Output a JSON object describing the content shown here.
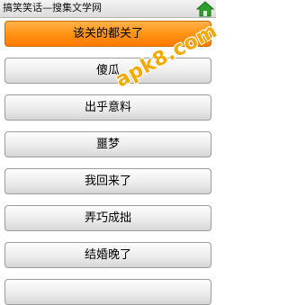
{
  "app": {
    "title": "搞笑笑话—搜集文学网"
  },
  "watermark": {
    "text": "apk8.com"
  },
  "colors": {
    "selected_item": "#ff9415",
    "home_icon": "#2e9e2e"
  },
  "icons": {
    "home": "home-icon"
  },
  "items": [
    {
      "label": "该关的都关了",
      "selected": true
    },
    {
      "label": "傻瓜",
      "selected": false
    },
    {
      "label": "出乎意料",
      "selected": false
    },
    {
      "label": "噩梦",
      "selected": false
    },
    {
      "label": "我回来了",
      "selected": false
    },
    {
      "label": "弄巧成拙",
      "selected": false
    },
    {
      "label": "结婚晚了",
      "selected": false
    },
    {
      "label": "",
      "selected": false
    }
  ]
}
